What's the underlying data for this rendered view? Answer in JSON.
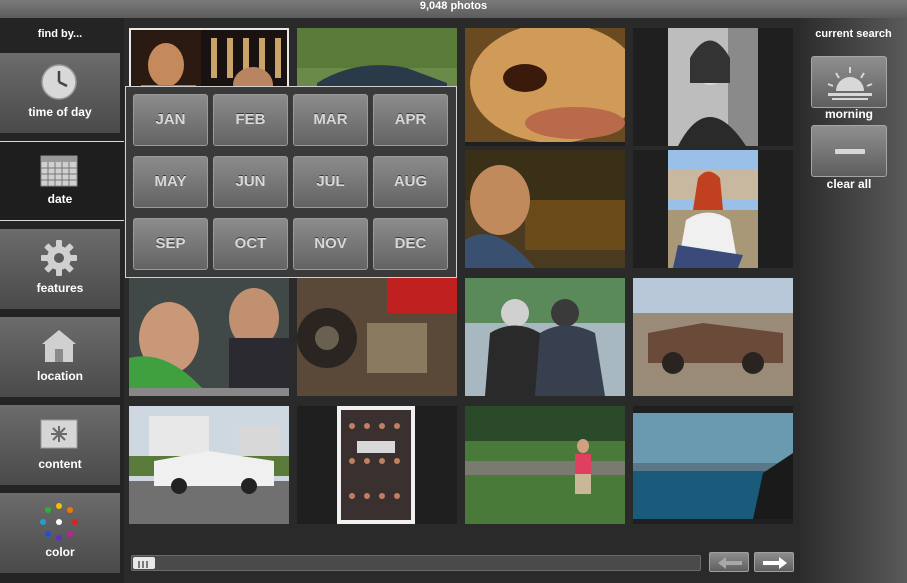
{
  "header": {
    "photo_count": "9,048 photos"
  },
  "sidebar": {
    "title": "find by...",
    "items": [
      {
        "label": "time of day",
        "icon": "clock-icon",
        "active": false
      },
      {
        "label": "date",
        "icon": "calendar-icon",
        "active": true
      },
      {
        "label": "features",
        "icon": "gear-icon",
        "active": false
      },
      {
        "label": "location",
        "icon": "house-icon",
        "active": false
      },
      {
        "label": "content",
        "icon": "asterisk-icon",
        "active": false
      },
      {
        "label": "color",
        "icon": "color-wheel-icon",
        "active": false
      }
    ]
  },
  "month_picker": {
    "months": [
      "JAN",
      "FEB",
      "MAR",
      "APR",
      "MAY",
      "JUN",
      "JUL",
      "AUG",
      "SEP",
      "OCT",
      "NOV",
      "DEC"
    ]
  },
  "current_search": {
    "title": "current search",
    "filters": [
      {
        "label": "morning",
        "icon": "sunrise-icon"
      }
    ],
    "clear_label": "clear all",
    "clear_icon": "minus-icon"
  },
  "pager": {
    "prev_icon": "arrow-left-icon",
    "next_icon": "arrow-right-icon",
    "scroll_thumb_icon": "grip-icon"
  },
  "colors": {
    "panel": "#242424",
    "button_gradient_top": "#8c8c8c",
    "button_gradient_bottom": "#636363",
    "popup_border": "#d0d0d0"
  }
}
